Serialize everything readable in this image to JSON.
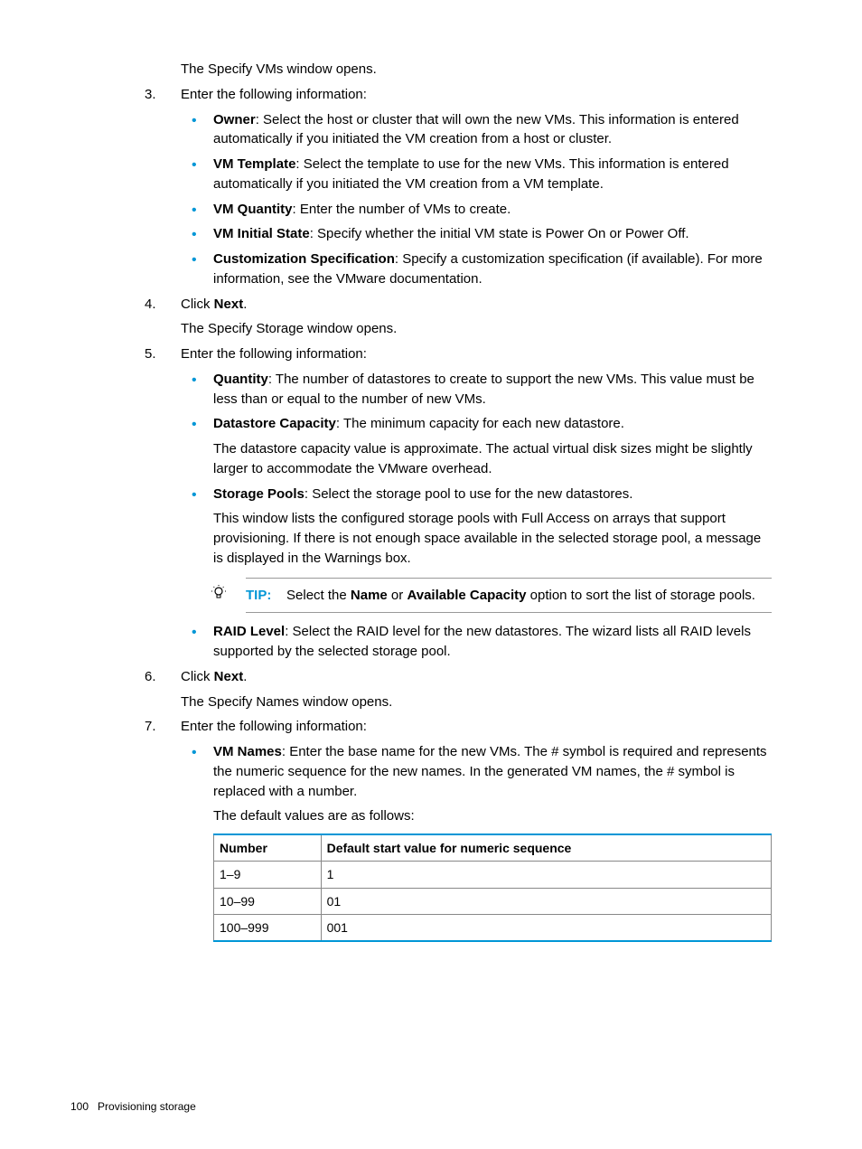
{
  "intro_text": "The Specify VMs window opens.",
  "steps": {
    "s3": {
      "num": "3.",
      "lead": "Enter the following information:",
      "bullets": [
        {
          "label": "Owner",
          "text": ": Select the host or cluster that will own the new VMs. This information is entered automatically if you initiated the VM creation from a host or cluster."
        },
        {
          "label": "VM Template",
          "text": ": Select the template to use for the new VMs. This information is entered automatically if you initiated the VM creation from a VM template."
        },
        {
          "label": "VM Quantity",
          "text": ": Enter the number of VMs to create."
        },
        {
          "label": "VM Initial State",
          "text": ": Specify whether the initial VM state is Power On or Power Off."
        },
        {
          "label": "Customization Specification",
          "text": ": Specify a customization specification (if available). For more information, see the VMware documentation."
        }
      ]
    },
    "s4": {
      "num": "4.",
      "lead_pre": "Click ",
      "lead_bold": "Next",
      "lead_post": ".",
      "after": "The Specify Storage window opens."
    },
    "s5": {
      "num": "5.",
      "lead": "Enter the following information:",
      "bullets": {
        "b0": {
          "label": "Quantity",
          "text": ": The number of datastores to create to support the new VMs. This value must be less than or equal to the number of new VMs."
        },
        "b1": {
          "label": "Datastore Capacity",
          "text": ": The minimum capacity for each new datastore.",
          "extra": "The datastore capacity value is approximate. The actual virtual disk sizes might be slightly larger to accommodate the VMware overhead."
        },
        "b2": {
          "label": "Storage Pools",
          "text": ": Select the storage pool to use for the new datastores.",
          "extra": "This window lists the configured storage pools with Full Access on arrays that support provisioning. If there is not enough space available in the selected storage pool, a message is displayed in the Warnings box."
        },
        "b3": {
          "label": "RAID Level",
          "text": ": Select the RAID level for the new datastores. The wizard lists all RAID levels supported by the selected storage pool."
        }
      },
      "tip": {
        "label": "TIP:",
        "pre": "Select the ",
        "b1": "Name",
        "mid": " or ",
        "b2": "Available Capacity",
        "post": " option to sort the list of storage pools."
      }
    },
    "s6": {
      "num": "6.",
      "lead_pre": "Click ",
      "lead_bold": "Next",
      "lead_post": ".",
      "after": "The Specify Names window opens."
    },
    "s7": {
      "num": "7.",
      "lead": "Enter the following information:",
      "bullet": {
        "label": "VM Names",
        "text": ": Enter the base name for the new VMs. The # symbol is required and represents the numeric sequence for the new names. In the generated VM names, the # symbol is replaced with a number.",
        "extra": "The default values are as follows:"
      },
      "table": {
        "header": {
          "c1": "Number",
          "c2": "Default start value for numeric sequence"
        },
        "rows": [
          {
            "c1": "1–9",
            "c2": "1"
          },
          {
            "c1": "10–99",
            "c2": "01"
          },
          {
            "c1": "100–999",
            "c2": "001"
          }
        ]
      }
    }
  },
  "footer": {
    "page": "100",
    "title": "Provisioning storage"
  }
}
